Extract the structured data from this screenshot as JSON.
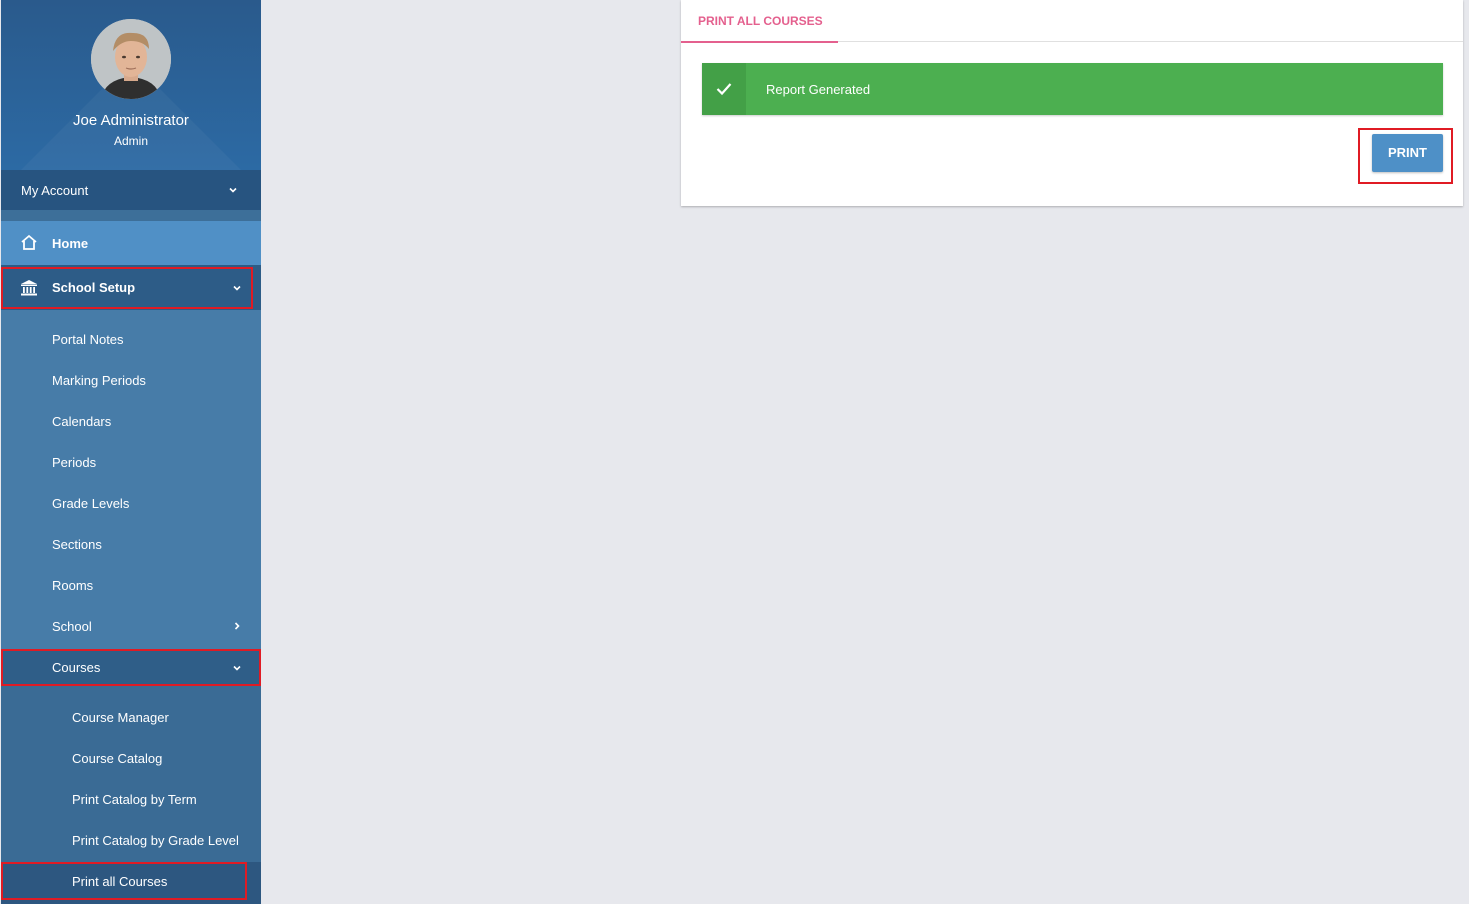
{
  "profile": {
    "name": "Joe Administrator",
    "role": "Admin"
  },
  "sidebar": {
    "my_account": "My Account",
    "home": "Home",
    "school_setup": "School Setup",
    "school_setup_items": [
      "Portal Notes",
      "Marking Periods",
      "Calendars",
      "Periods",
      "Grade Levels",
      "Sections",
      "Rooms",
      "School"
    ],
    "courses": "Courses",
    "courses_items": [
      "Course Manager",
      "Course Catalog",
      "Print Catalog by Term",
      "Print Catalog by Grade Level",
      "Print all Courses"
    ]
  },
  "main": {
    "tab_label": "PRINT ALL COURSES",
    "alert_text": "Report Generated",
    "print_label": "PRINT"
  },
  "colors": {
    "accent_pink": "#e4608e",
    "success_green": "#4caf50",
    "button_blue": "#4e90c7",
    "highlight_red": "#e01b24"
  },
  "icons": {
    "home": "home-icon",
    "school_setup": "bank-icon",
    "alert": "check-icon"
  }
}
